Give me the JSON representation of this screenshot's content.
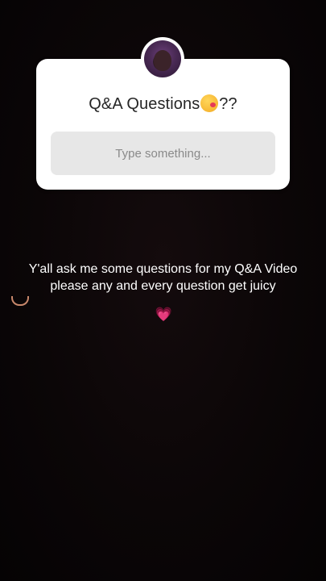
{
  "sticker": {
    "title": "Q&A Questions",
    "title_suffix": "??",
    "title_emoji": "kissing-face-emoji",
    "placeholder": "Type something..."
  },
  "caption": {
    "line1": "Y'all ask me some questions for my Q&A Video",
    "line2": "please any and every question get juicy",
    "emojis": [
      "heart-hands-emoji",
      "pink-heart-emoji"
    ],
    "heart_glyph": "💗"
  },
  "colors": {
    "sticker_bg": "#ffffff",
    "field_bg": "#e7e7e7",
    "background": "#0b0607",
    "avatar_ring": "#6b3f7a"
  }
}
